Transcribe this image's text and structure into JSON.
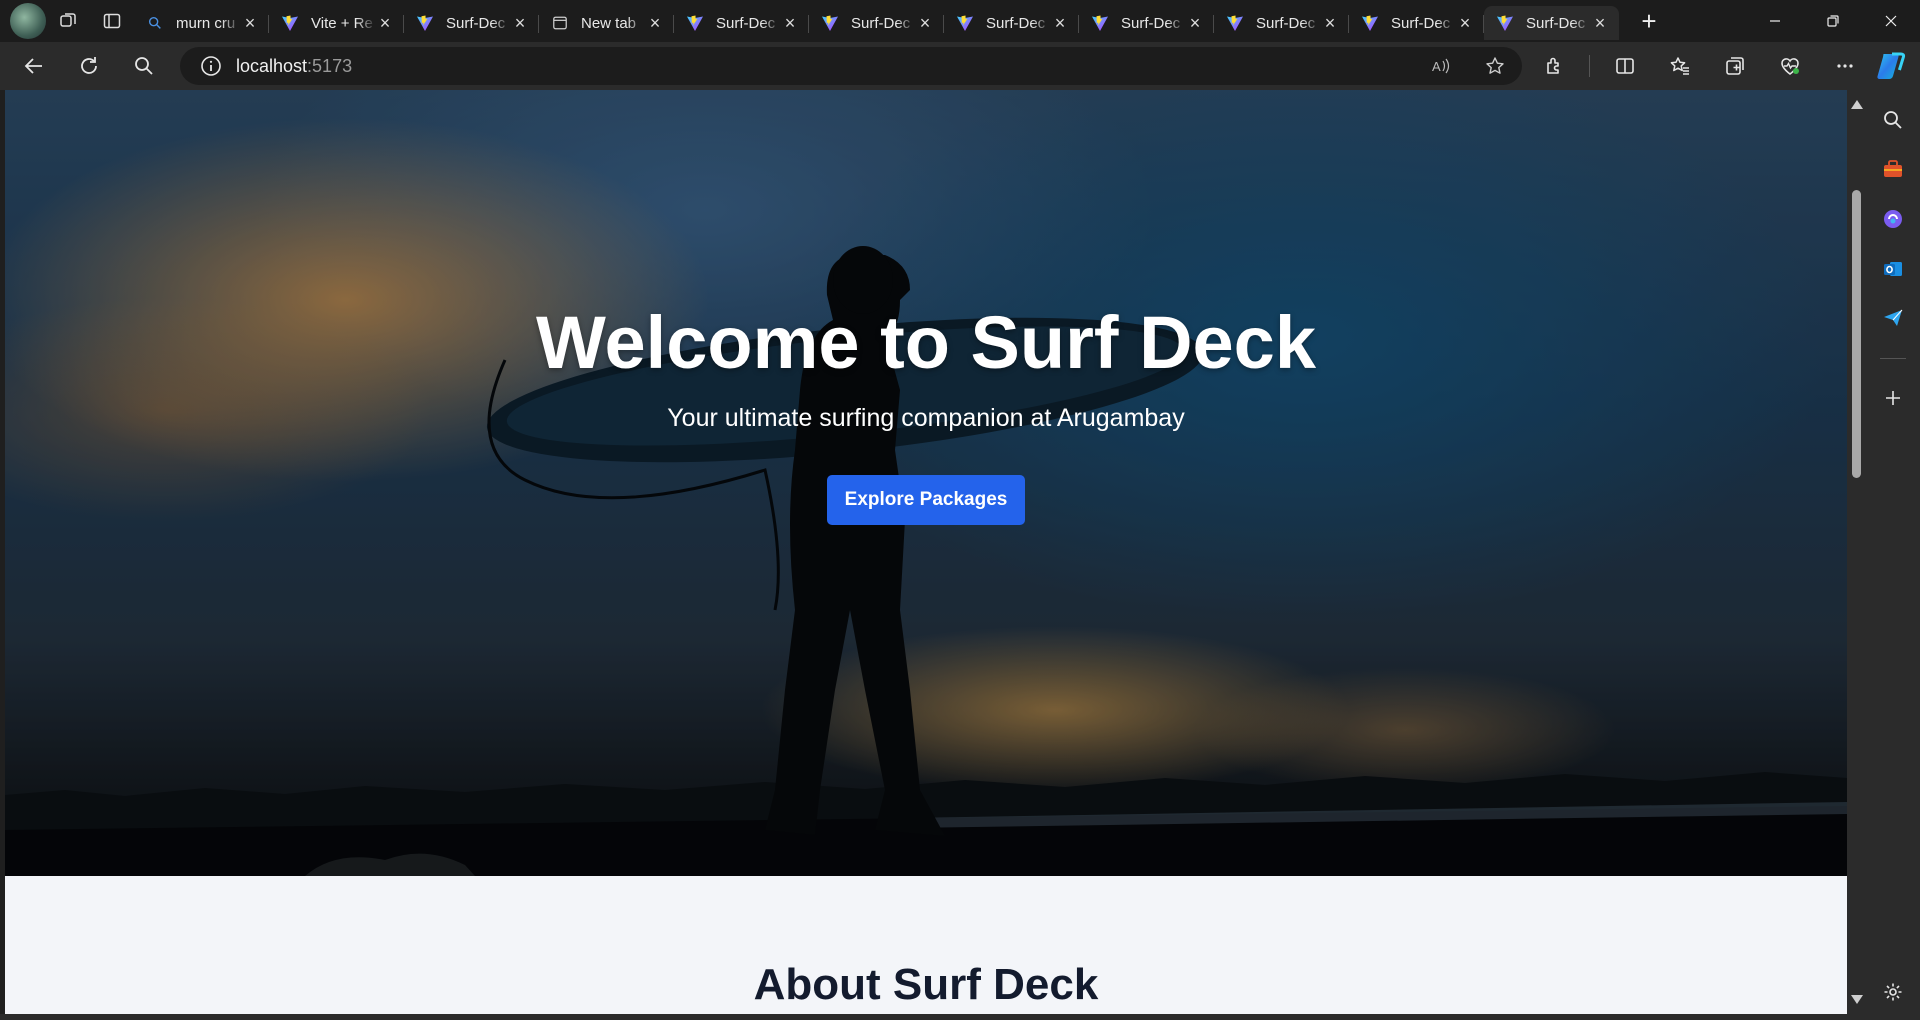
{
  "browser": {
    "tabs": [
      {
        "title": "murn cru",
        "icon": "search-icon",
        "active": false
      },
      {
        "title": "Vite + Re",
        "icon": "vite-icon",
        "active": false
      },
      {
        "title": "Surf-Dec",
        "icon": "vite-icon",
        "active": false
      },
      {
        "title": "New tab",
        "icon": "new-tab-page-icon",
        "active": false
      },
      {
        "title": "Surf-Dec",
        "icon": "vite-icon",
        "active": false
      },
      {
        "title": "Surf-Dec",
        "icon": "vite-icon",
        "active": false
      },
      {
        "title": "Surf-Dec",
        "icon": "vite-icon",
        "active": false
      },
      {
        "title": "Surf-Dec",
        "icon": "vite-icon",
        "active": false
      },
      {
        "title": "Surf-Dec",
        "icon": "vite-icon",
        "active": false
      },
      {
        "title": "Surf-Dec",
        "icon": "vite-icon",
        "active": false
      },
      {
        "title": "Surf-Dec",
        "icon": "vite-icon",
        "active": true
      }
    ],
    "address": {
      "host": "localhost",
      "port": ":5173"
    },
    "accent": "#2463eb"
  },
  "page": {
    "hero": {
      "title": "Welcome to Surf Deck",
      "subtitle": "Your ultimate surfing companion at Arugambay",
      "cta": "Explore Packages"
    },
    "about": {
      "title": "About Surf Deck"
    },
    "colors": {
      "button": "#2463eb",
      "section_bg": "#f3f5f9",
      "heading": "#131b2e"
    }
  }
}
